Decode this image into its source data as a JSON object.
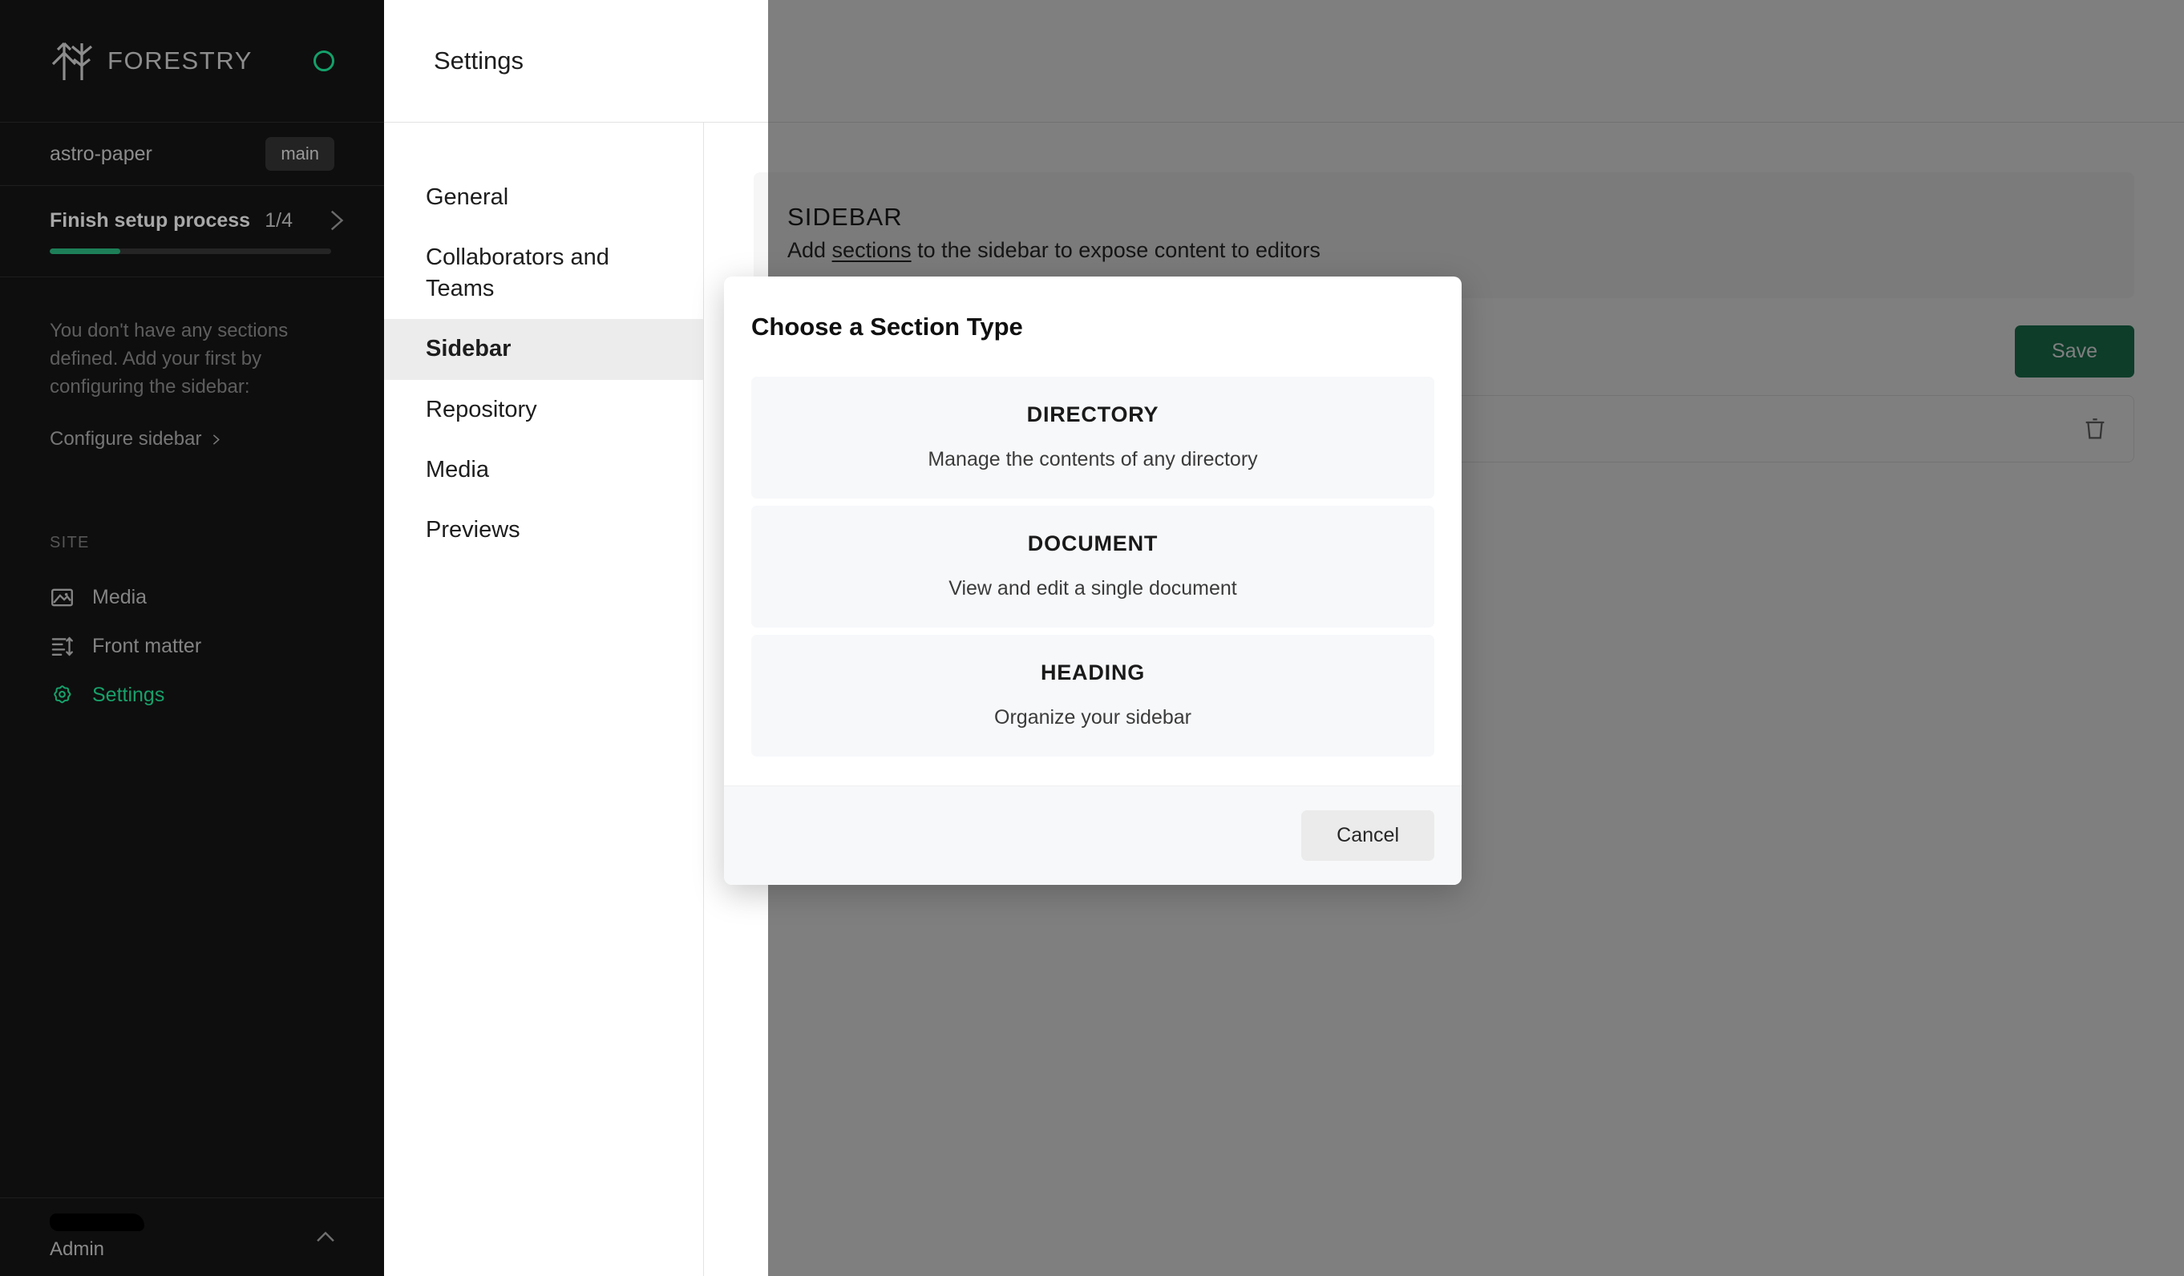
{
  "sidebar": {
    "brand": {
      "name": "FORESTRY",
      "logo_icon": "forest-trees-logo",
      "status_icon": "status-ring-icon",
      "status_color": "#14a06a"
    },
    "repository": {
      "name": "astro-paper",
      "branch": "main"
    },
    "setup": {
      "title": "Finish setup process",
      "count": "1/4",
      "progress_percent": 25,
      "chevron_icon": "chevron-right-icon",
      "progress_color": "#1d7f58"
    },
    "empty_state": {
      "message": "You don't have any sections defined. Add your first by configuring the sidebar:",
      "link": "Configure sidebar",
      "link_icon": "chevron-right-icon"
    },
    "nav": {
      "label": "SITE",
      "items": [
        {
          "label": "Media",
          "icon": "image-icon",
          "active": false
        },
        {
          "label": "Front matter",
          "icon": "list-sort-icon",
          "active": false
        },
        {
          "label": "Settings",
          "icon": "gear-icon",
          "active": true
        }
      ]
    },
    "user": {
      "name_redacted": true,
      "role": "Admin",
      "chevron_icon": "chevron-up-icon"
    }
  },
  "header": {
    "title": "Settings"
  },
  "settings_nav": {
    "items": [
      {
        "label": "General",
        "active": false
      },
      {
        "label": "Collaborators and Teams",
        "active": false
      },
      {
        "label": "Sidebar",
        "active": true
      },
      {
        "label": "Repository",
        "active": false
      },
      {
        "label": "Media",
        "active": false
      },
      {
        "label": "Previews",
        "active": false
      }
    ]
  },
  "content": {
    "card": {
      "title": "SIDEBAR",
      "subtitle_before": "Add ",
      "subtitle_link": "sections",
      "subtitle_after": " to the sidebar to expose content to editors"
    },
    "save_label": "Save",
    "save_color": "#1c7a55",
    "row": {
      "delete_icon": "trash-icon"
    }
  },
  "modal": {
    "title": "Choose a Section Type",
    "options": [
      {
        "name": "DIRECTORY",
        "description": "Manage the contents of any directory"
      },
      {
        "name": "DOCUMENT",
        "description": "View and edit a single document"
      },
      {
        "name": "HEADING",
        "description": "Organize your sidebar"
      }
    ],
    "cancel_label": "Cancel"
  }
}
